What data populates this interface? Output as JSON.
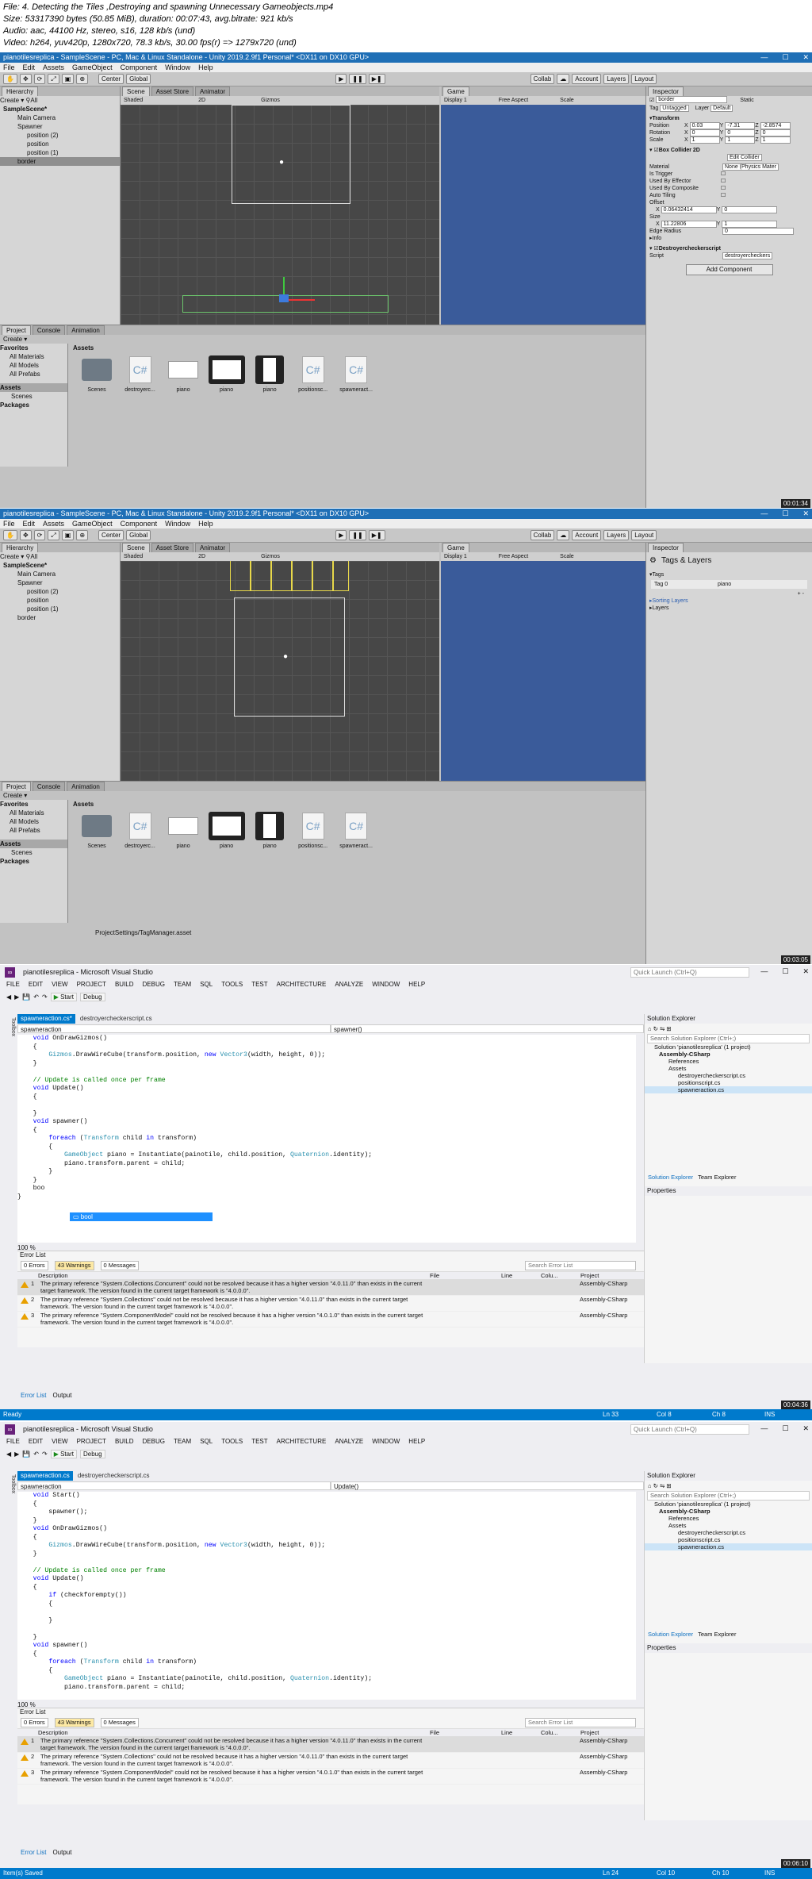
{
  "header": {
    "line1": "File: 4. Detecting the Tiles ,Destroying and spawning Unnecessary Gameobjects.mp4",
    "line2": "Size: 53317390 bytes (50.85 MiB), duration: 00:07:43, avg.bitrate: 921 kb/s",
    "line3": "Audio: aac, 44100 Hz, stereo, s16, 128 kb/s (und)",
    "line4": "Video: h264, yuv420p, 1280x720, 78.3 kb/s, 30.00 fps(r) => 1279x720 (und)"
  },
  "unity": {
    "title": "pianotilesreplica - SampleScene - PC, Mac & Linux Standalone - Unity 2019.2.9f1 Personal* <DX11 on DX10 GPU>",
    "menu": [
      "File",
      "Edit",
      "Assets",
      "GameObject",
      "Component",
      "Window",
      "Help"
    ],
    "toolbar": {
      "center": "Center",
      "global": "Global",
      "collab": "Collab",
      "account": "Account",
      "layers": "Layers",
      "layout": "Layout"
    },
    "tabs": {
      "hierarchy": "Hierarchy",
      "scene": "Scene",
      "asset_store": "Asset Store",
      "animator": "Animator",
      "game": "Game",
      "inspector": "Inspector",
      "project": "Project",
      "console": "Console",
      "animation": "Animation"
    },
    "create": "Create",
    "search_all": "All",
    "scene_bar": {
      "shaded": "Shaded",
      "mode2d": "2D",
      "gizmos": "Gizmos",
      "display": "Display 1",
      "aspect": "Free Aspect",
      "scale": "Scale"
    },
    "hierarchy": [
      "SampleScene*",
      "Main Camera",
      "Spawner",
      "position (2)",
      "position",
      "position (1)",
      "border"
    ],
    "favorites": [
      "Favorites",
      "All Materials",
      "All Models",
      "All Prefabs"
    ],
    "assets_tree": [
      "Assets",
      "Scenes",
      "Packages"
    ],
    "assets_label": "Assets",
    "assets": [
      "Scenes",
      "destroyerc...",
      "piano",
      "piano",
      "piano",
      "positionsc...",
      "spawneract..."
    ],
    "inspector1": {
      "name": "border",
      "static": "Static",
      "tag_label": "Tag",
      "tag": "Untagged",
      "layer_label": "Layer",
      "layer": "Default",
      "transform": "Transform",
      "position": {
        "label": "Position",
        "x": "0.03",
        "y": "-7.31",
        "z": "-2.8574"
      },
      "rotation": {
        "label": "Rotation",
        "x": "0",
        "y": "0",
        "z": "0"
      },
      "scale": {
        "label": "Scale",
        "x": "1",
        "y": "1",
        "z": "1"
      },
      "collider": "Box Collider 2D",
      "edit_collider": "Edit Collider",
      "material": {
        "label": "Material",
        "value": "None (Physics Mater"
      },
      "checks": [
        "Is Trigger",
        "Used By Effector",
        "Used By Composite",
        "Auto Tiling"
      ],
      "offset": {
        "label": "Offset",
        "x": "0.06432414",
        "y": "0"
      },
      "size": {
        "label": "Size",
        "x": "11.22806",
        "y": "1"
      },
      "edge_radius": {
        "label": "Edge Radius",
        "value": "0"
      },
      "info": "Info",
      "script_comp": "Destroyercheckerscript",
      "script": {
        "label": "Script",
        "value": "destroyercheckers"
      },
      "add_component": "Add Component"
    },
    "inspector2": {
      "title": "Tags & Layers",
      "tags": "Tags",
      "tag0": "Tag 0",
      "tag0_value": "piano",
      "sorting": "Sorting Layers",
      "layers": "Layers"
    },
    "footer2": "ProjectSettings/TagManager.asset",
    "timestamps": [
      "00:01:34",
      "00:03:05"
    ]
  },
  "vs": {
    "title": "pianotilesreplica - Microsoft Visual Studio",
    "quick_launch": "Quick Launch (Ctrl+Q)",
    "menu": [
      "FILE",
      "EDIT",
      "VIEW",
      "PROJECT",
      "BUILD",
      "DEBUG",
      "TEAM",
      "SQL",
      "TOOLS",
      "TEST",
      "ARCHITECTURE",
      "ANALYZE",
      "WINDOW",
      "HELP"
    ],
    "start": "Start",
    "debug": "Debug",
    "toolbox": "Toolbox",
    "tab1": "spawneraction.cs*",
    "tab2": "destroyercheckerscript.cs",
    "nav_left": "spawneraction",
    "nav_right1": "spawner()",
    "nav_right2": "Update()",
    "code1": [
      "    void OnDrawGizmos()",
      "    {",
      "        Gizmos.DrawWireCube(transform.position, new Vector3(width, height, 0));",
      "    }",
      "",
      "    // Update is called once per frame",
      "    void Update()",
      "    {",
      "",
      "    }",
      "    void spawner()",
      "    {",
      "        foreach (Transform child in transform)",
      "        {",
      "            GameObject piano = Instantiate(painotile, child.position, Quaternion.identity);",
      "            piano.transform.parent = child;",
      "        }",
      "    }",
      "    boo",
      "}"
    ],
    "autocomplete": "bool",
    "code2": [
      "    void Start()",
      "    {",
      "        spawner();",
      "    }",
      "    void OnDrawGizmos()",
      "    {",
      "        Gizmos.DrawWireCube(transform.position, new Vector3(width, height, 0));",
      "    }",
      "",
      "    // Update is called once per frame",
      "    void Update()",
      "    {",
      "        if (checkforempty())",
      "        {",
      "",
      "        }",
      "",
      "    }",
      "    void spawner()",
      "    {",
      "        foreach (Transform child in transform)",
      "        {",
      "            GameObject piano = Instantiate(painotile, child.position, Quaternion.identity);",
      "            piano.transform.parent = child;"
    ],
    "zoom": "100 %",
    "solution_explorer": "Solution Explorer",
    "search_se": "Search Solution Explorer (Ctrl+;)",
    "solution": "Solution 'pianotilesreplica' (1 project)",
    "project": "Assembly-CSharp",
    "references": "References",
    "assets_folder": "Assets",
    "files": [
      "destroyercheckerscript.cs",
      "positionscript.cs",
      "spawneraction.cs"
    ],
    "se_tabs": [
      "Solution Explorer",
      "Team Explorer"
    ],
    "properties": "Properties",
    "error_list": "Error List",
    "errors": "0 Errors",
    "warnings": "43 Warnings",
    "messages": "0 Messages",
    "search_errors": "Search Error List",
    "cols": [
      "Description",
      "File",
      "Line",
      "Colu...",
      "Project"
    ],
    "rows": [
      {
        "n": "1",
        "desc": "The primary reference \"System.Collections.Concurrent\" could not be resolved because it has a higher version \"4.0.11.0\" than exists in the current target framework. The version found in the current target framework is \"4.0.0.0\".",
        "project": "Assembly-CSharp"
      },
      {
        "n": "2",
        "desc": "The primary reference \"System.Collections\" could not be resolved because it has a higher version \"4.0.11.0\" than exists in the current target framework. The version found in the current target framework is \"4.0.0.0\".",
        "project": "Assembly-CSharp"
      },
      {
        "n": "3",
        "desc": "The primary reference \"System.ComponentModel\" could not be resolved because it has a higher version \"4.0.1.0\" than exists in the current target framework. The version found in the current target framework is \"4.0.0.0\".",
        "project": "Assembly-CSharp"
      }
    ],
    "bottom_tabs": [
      "Error List",
      "Output"
    ],
    "status1": {
      "left": "Ready",
      "ln": "Ln 33",
      "col": "Col 8",
      "ch": "Ch 8",
      "ins": "INS"
    },
    "status2": {
      "left": "Item(s) Saved",
      "ln": "Ln 24",
      "col": "Col 10",
      "ch": "Ch 10",
      "ins": "INS"
    },
    "timestamps": [
      "00:04:36",
      "00:06:10"
    ]
  }
}
